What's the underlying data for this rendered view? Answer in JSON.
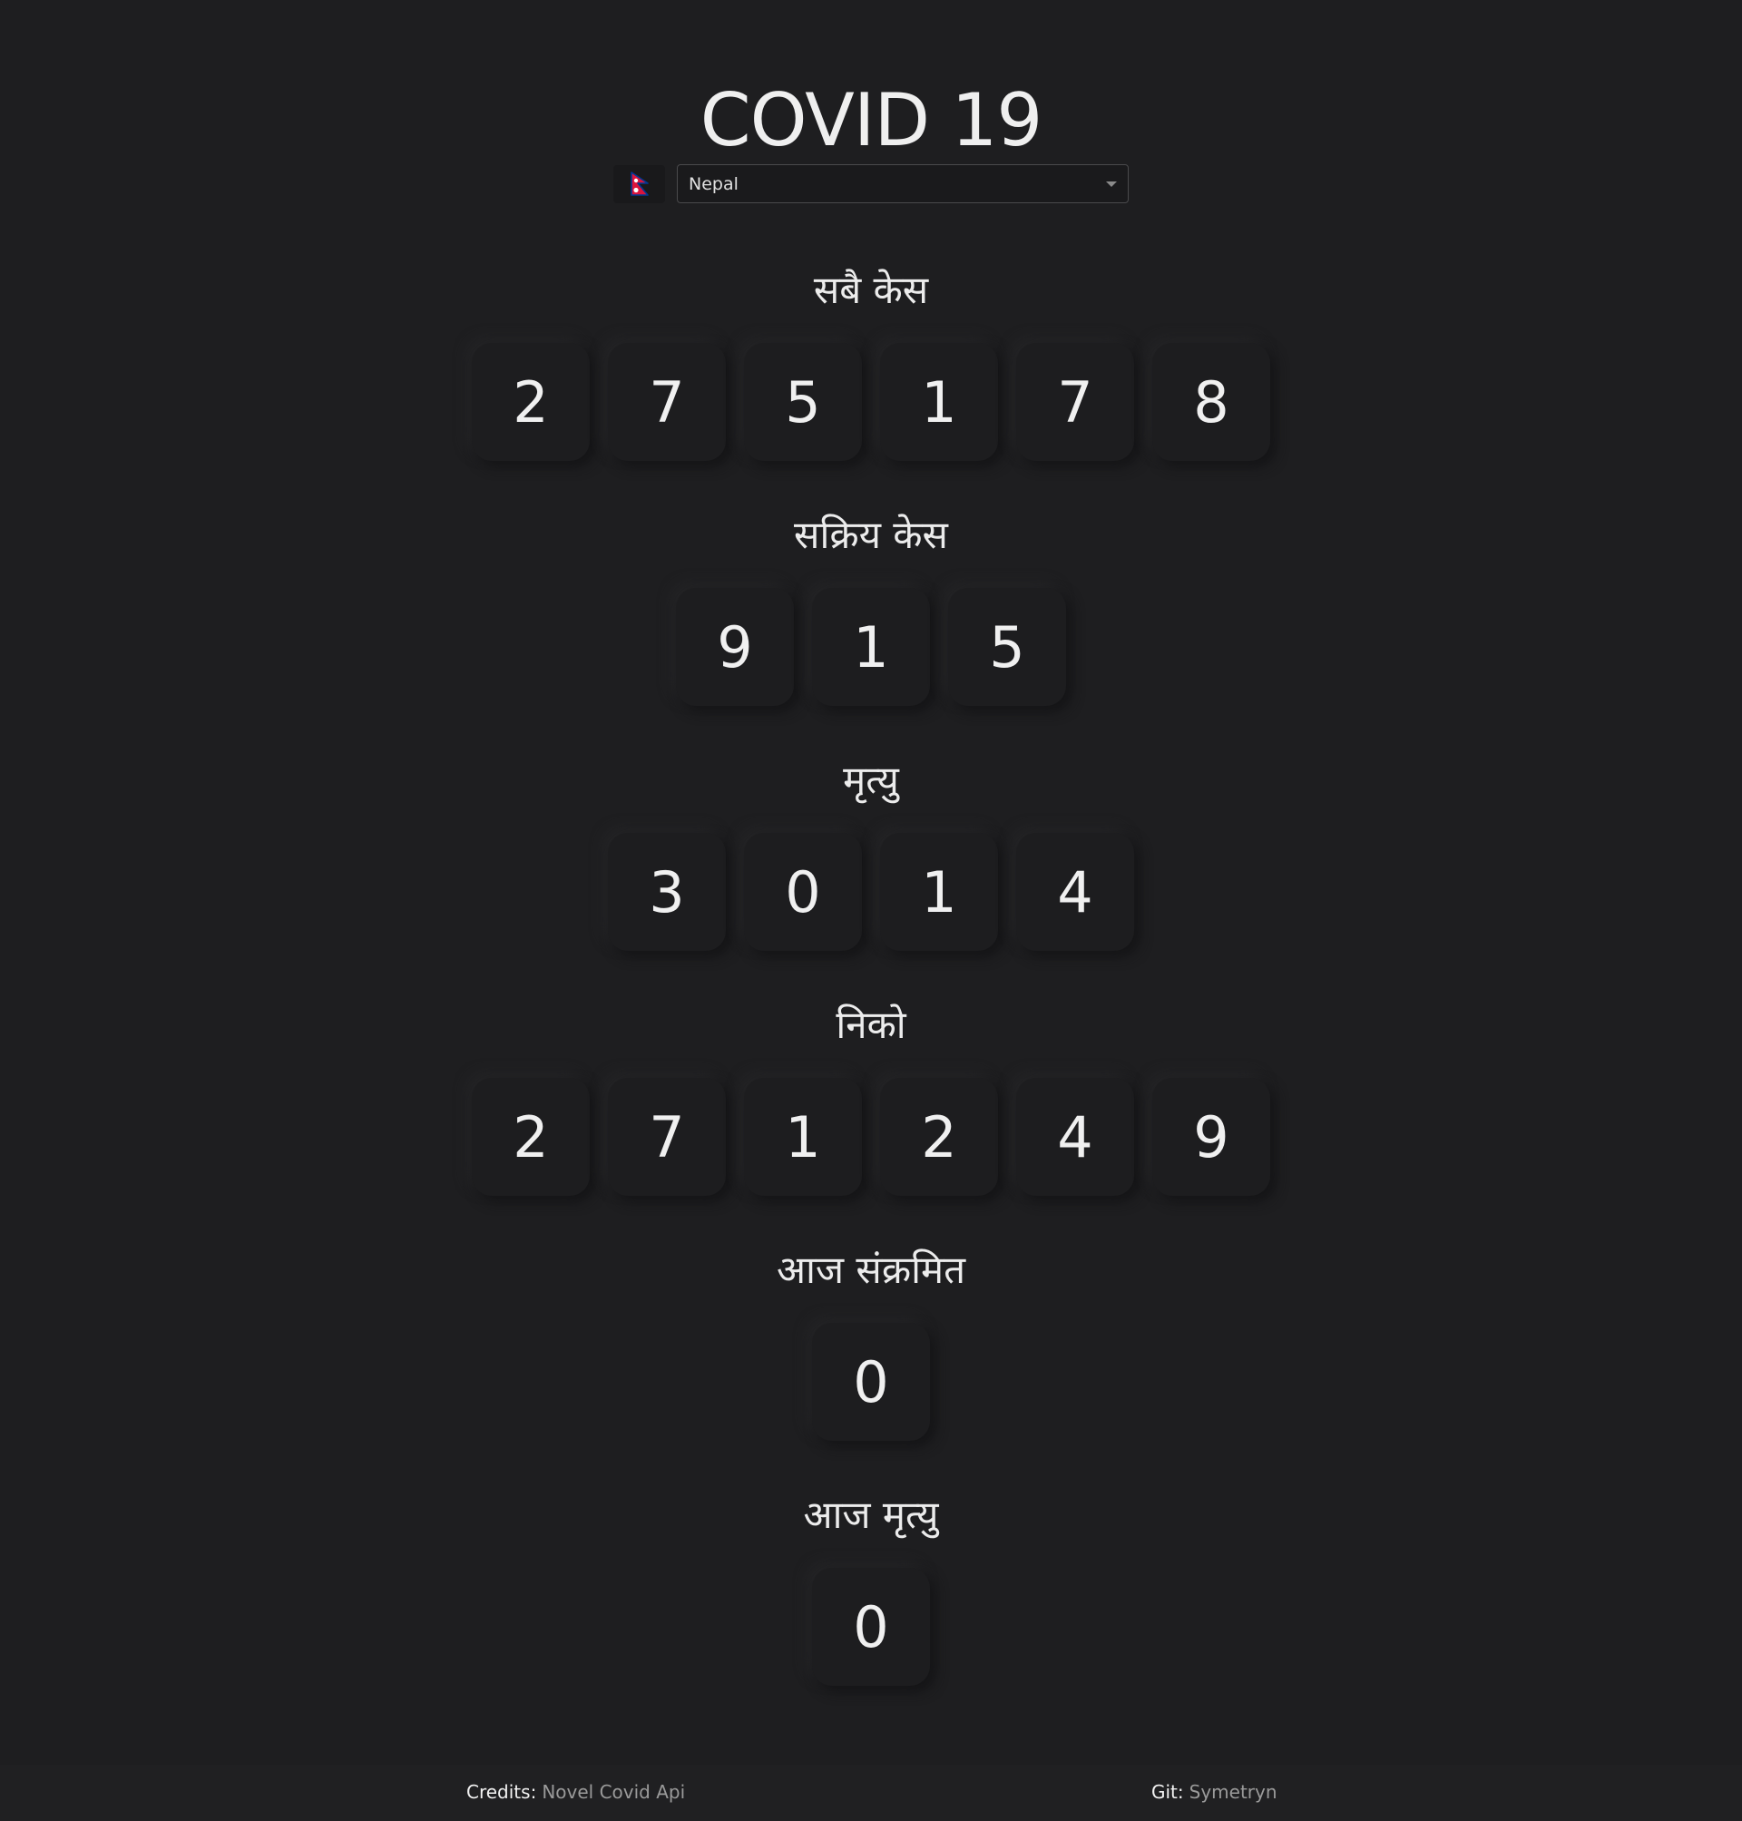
{
  "page": {
    "title": "COVID 19"
  },
  "selector": {
    "flag_icon": "nepal-flag-icon",
    "selected": "Nepal",
    "colors": {
      "flag_red": "#dc143c",
      "flag_border": "#003893"
    }
  },
  "stats": [
    {
      "label": "सबै केस",
      "value": "275178",
      "digits": [
        "2",
        "7",
        "5",
        "1",
        "7",
        "8"
      ]
    },
    {
      "label": "सक्रिय केस",
      "value": "915",
      "digits": [
        "9",
        "1",
        "5"
      ]
    },
    {
      "label": "मृत्यु",
      "value": "3014",
      "digits": [
        "3",
        "0",
        "1",
        "4"
      ]
    },
    {
      "label": "निको",
      "value": "271249",
      "digits": [
        "2",
        "7",
        "1",
        "2",
        "4",
        "9"
      ]
    },
    {
      "label": "आज संक्रमित",
      "value": "0",
      "digits": [
        "0"
      ]
    },
    {
      "label": "आज मृत्यु",
      "value": "0",
      "digits": [
        "0"
      ]
    }
  ],
  "footer": {
    "credits_label": "Credits:",
    "credits_link": "Novel Covid Api",
    "git_label": "Git:",
    "git_link": "Symetryn"
  }
}
